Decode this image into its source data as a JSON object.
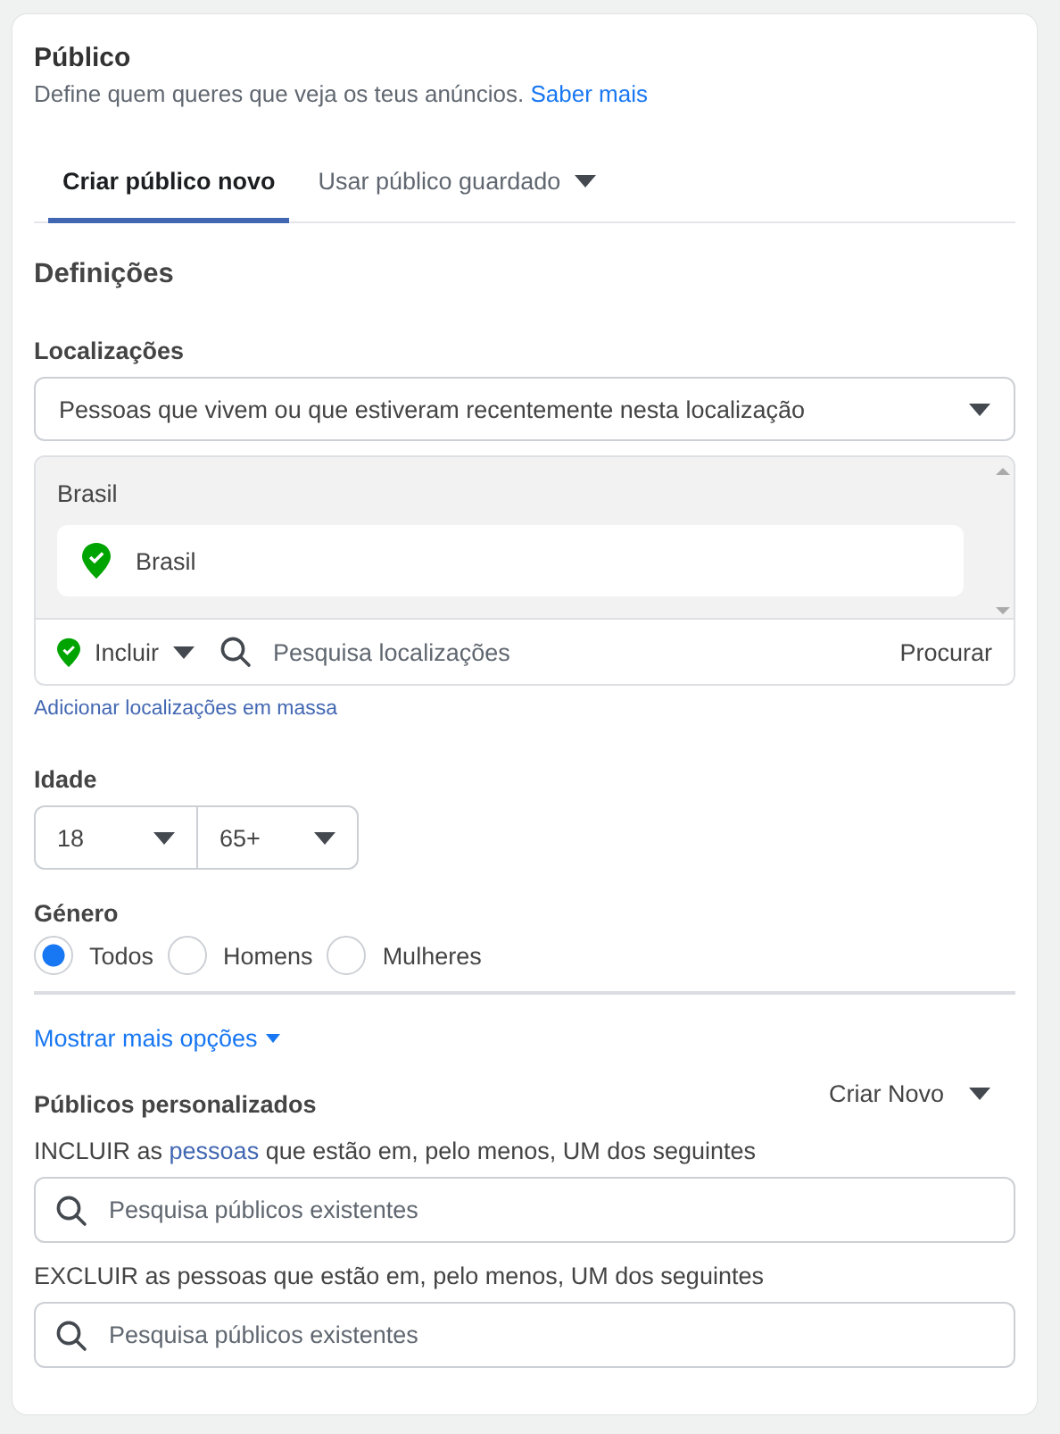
{
  "header": {
    "title": "Público",
    "subtitle": "Define quem queres que veja os teus anúncios.",
    "link": "Saber mais"
  },
  "tabs": [
    {
      "label": "Criar público novo",
      "selected": true,
      "has_menu": false
    },
    {
      "label": "Usar público guardado",
      "selected": false,
      "has_menu": true
    }
  ],
  "section_title": "Definições",
  "locations": {
    "label": "Localizações",
    "mode": "Pessoas que vivem ou que estiveram recentemente nesta localização",
    "group": "Brasil",
    "items": [
      {
        "name": "Brasil"
      }
    ],
    "include_label": "Incluir",
    "search_placeholder": "Pesquisa localizações",
    "browse": "Procurar",
    "bulk_link": "Adicionar localizações em massa"
  },
  "age": {
    "label": "Idade",
    "min": "18",
    "max": "65+"
  },
  "gender": {
    "label": "Género",
    "options": [
      {
        "label": "Todos",
        "selected": true
      },
      {
        "label": "Homens",
        "selected": false
      },
      {
        "label": "Mulheres",
        "selected": false
      }
    ]
  },
  "more_options": "Mostrar mais opções",
  "custom_audiences": {
    "label": "Públicos personalizados",
    "create": "Criar Novo",
    "include": {
      "before": "INCLUIR as ",
      "link": "pessoas",
      "after": " que estão em, pelo menos, UM dos seguintes",
      "placeholder": "Pesquisa públicos existentes"
    },
    "exclude": {
      "text": "EXCLUIR as pessoas que estão em, pelo menos, UM dos seguintes",
      "placeholder": "Pesquisa públicos existentes"
    }
  }
}
